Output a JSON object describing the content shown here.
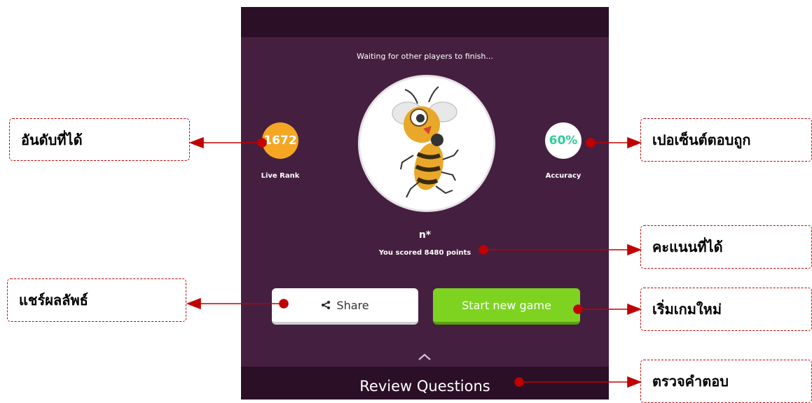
{
  "game": {
    "waiting_text": "Waiting for other players to finish...",
    "live_rank_value": "1672",
    "live_rank_label": "Live Rank",
    "accuracy_value": "60%",
    "accuracy_label": "Accuracy",
    "player_name": "n*",
    "score_text": "You scored 8480 points",
    "share_label": "Share",
    "start_new_game_label": "Start new game",
    "review_questions_label": "Review Questions"
  },
  "annotations": {
    "rank": "อันดับที่ได้",
    "accuracy": "เปอเซ็นต์ตอบถูก",
    "score": "คะแนนที่ได้",
    "share": "แชร์ผลลัพธ์",
    "new_game": "เริ่มเกมใหม่",
    "review": "ตรวจคำตอบ"
  },
  "colors": {
    "panel_bg": "#451f40",
    "panel_dark": "#2a0f27",
    "rank_orange": "#f5a623",
    "accuracy_green": "#2ecc9a",
    "start_button_green": "#7ed321",
    "annotation_red": "#c00000"
  },
  "icons": {
    "share": "share-icon",
    "chevron": "chevron-up-icon",
    "avatar": "bee-avatar"
  }
}
